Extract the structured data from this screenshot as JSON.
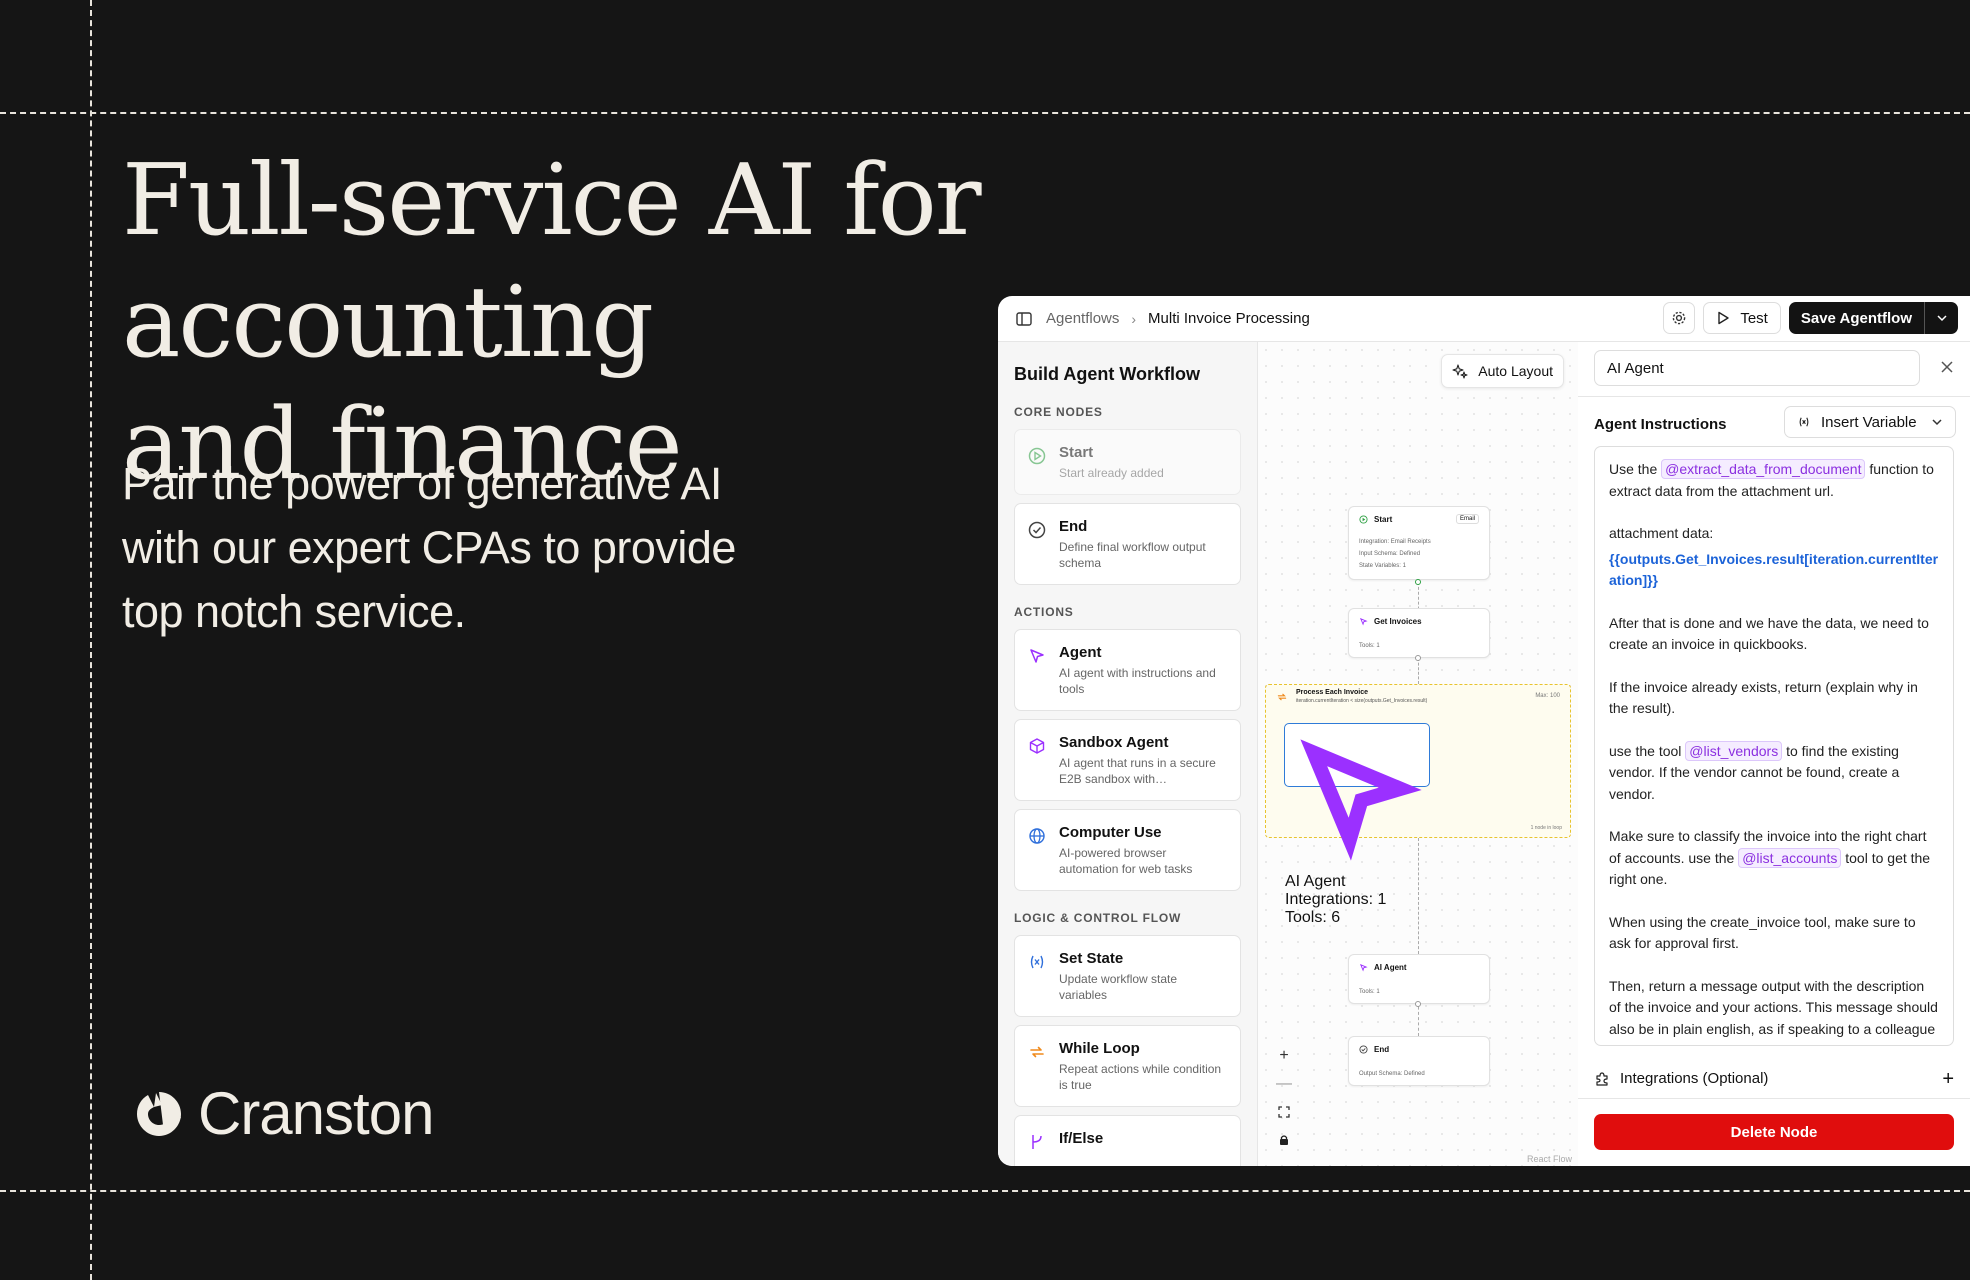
{
  "hero": {
    "title_line1": "Full-service AI for accounting",
    "title_line2": "and finance",
    "subtitle": "Pair the power of generative AI with our expert CPAs to provide top notch service."
  },
  "brand": {
    "name": "Cranston"
  },
  "app": {
    "topbar": {
      "breadcrumb_root": "Agentflows",
      "breadcrumb_current": "Multi Invoice Processing",
      "test_label": "Test",
      "save_label": "Save Agentflow"
    },
    "sidebar": {
      "title": "Build Agent Workflow",
      "sections": {
        "core": "CORE NODES",
        "actions": "ACTIONS",
        "logic": "LOGIC & CONTROL FLOW"
      },
      "core_items": [
        {
          "title": "Start",
          "desc": "Start already added",
          "icon": "play-circle-icon",
          "color": "#2ea043"
        },
        {
          "title": "End",
          "desc": "Define final workflow output schema",
          "icon": "check-circle-icon",
          "color": "#444444"
        }
      ],
      "action_items": [
        {
          "title": "Agent",
          "desc": "AI agent with instructions and tools",
          "icon": "cursor-icon",
          "color": "#9b30ff"
        },
        {
          "title": "Sandbox Agent",
          "desc": "AI agent that runs in a secure E2B sandbox with…",
          "icon": "cube-icon",
          "color": "#9b30ff"
        },
        {
          "title": "Computer Use",
          "desc": "AI-powered browser automation for web tasks",
          "icon": "globe-icon",
          "color": "#2f6fdb"
        }
      ],
      "logic_items": [
        {
          "title": "Set State",
          "desc": "Update workflow state variables",
          "icon": "variable-icon",
          "color": "#2f6fdb"
        },
        {
          "title": "While Loop",
          "desc": "Repeat actions while condition is true",
          "icon": "loop-icon",
          "color": "#f08a1c"
        },
        {
          "title": "If/Else",
          "desc": "",
          "icon": "branch-icon",
          "color": "#9b30ff"
        }
      ]
    },
    "canvas": {
      "auto_layout_label": "Auto Layout",
      "nodes": {
        "start": {
          "title": "Start",
          "badge": "Email",
          "lines": [
            "Integration: Email Receipts",
            "Input Schema: Defined",
            "State Variables: 1"
          ]
        },
        "get_invoices": {
          "title": "Get Invoices",
          "lines": [
            "Tools: 1"
          ]
        },
        "loop": {
          "title": "Process Each Invoice",
          "condition": "iteration.currentIteration < size(outputs.Get_Invoices.result)",
          "max": "Max: 100",
          "count": "1 node in loop"
        },
        "loop_agent": {
          "title": "AI Agent",
          "lines": [
            "Integrations: 1",
            "Tools: 6"
          ]
        },
        "ai_agent": {
          "title": "AI Agent",
          "lines": [
            "Tools: 1"
          ]
        },
        "end": {
          "title": "End",
          "lines": [
            "Output Schema: Defined"
          ]
        }
      },
      "zoom_controls": [
        "+",
        "—"
      ],
      "attribution": "React Flow"
    },
    "panel": {
      "node_name": "AI Agent",
      "instructions_label": "Agent Instructions",
      "insert_variable_label": "Insert Variable",
      "instructions": {
        "p1_pre": "Use the",
        "p1_tok": "@extract_data_from_document",
        "p1_post": "function to extract data from the attachment url.",
        "p2_label": "attachment data:",
        "p2_var": "{{outputs.Get_Invoices.result[iteration.currentIteration]}}",
        "p3": "After that is done and we have the data, we need to create an invoice in quickbooks.",
        "p4": "If the invoice already exists, return (explain why in the result).",
        "p5_pre": "use the tool",
        "p5_tok": "@list_vendors",
        "p5_post": "to find the existing vendor. If the vendor cannot be found, create a vendor.",
        "p6_pre": "Make sure to classify the invoice into the right chart of accounts. use the",
        "p6_tok": "@list_accounts",
        "p6_post": "tool to get the right one.",
        "p7": "When using the create_invoice tool, make sure to ask for approval first.",
        "p8": "Then, return a message output with the description of the invoice and your actions. This message should also be in plain english, as if speaking to a colleague over a slack thread."
      },
      "integrations_label": "Integrations (Optional)",
      "delete_label": "Delete Node"
    }
  },
  "colors": {
    "background": "#151515",
    "hero_text": "#f1ede5",
    "delete_red": "#e00d0d",
    "token_purple": "#8b2fe0",
    "variable_blue": "#1c63d8",
    "loop_border": "#e8c32e",
    "selected_blue": "#2f7bd8"
  }
}
